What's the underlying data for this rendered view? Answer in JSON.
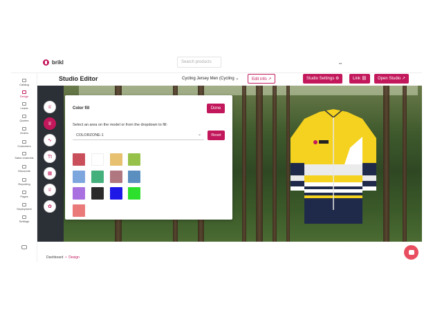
{
  "app": {
    "logo_text": "brikl"
  },
  "search": {
    "placeholder": "Search products"
  },
  "user": {
    "label": "•••"
  },
  "sidebar": {
    "items": [
      {
        "label": "Catalog"
      },
      {
        "label": "Design"
      },
      {
        "label": "Leads"
      },
      {
        "label": "Quotes"
      },
      {
        "label": "Orders"
      },
      {
        "label": "Customers"
      },
      {
        "label": "Sales channels"
      },
      {
        "label": "Discounts"
      },
      {
        "label": "Reporting"
      },
      {
        "label": "Pages"
      },
      {
        "label": "Deployment"
      },
      {
        "label": "Settings"
      }
    ]
  },
  "header": {
    "title": "Studio Editor",
    "product_select": "Cycling Jersey Men (Cycling",
    "edit_info": "Edit info",
    "studio_settings": "Studio Settings",
    "link": "Link",
    "open_studio": "Open Studio"
  },
  "tools": [
    {
      "icon": "jersey-icon"
    },
    {
      "icon": "color-fill-icon"
    },
    {
      "icon": "pattern-icon"
    },
    {
      "icon": "text-icon",
      "label": "Tt"
    },
    {
      "icon": "image-icon"
    },
    {
      "icon": "logo-icon"
    },
    {
      "icon": "sticker-icon"
    }
  ],
  "panel": {
    "title": "Color fill",
    "done": "Done",
    "instruction": "Select an area on the model or from the dropdown to fill:",
    "zone_value": "COLORZONE-1",
    "reset": "Reset",
    "swatches": [
      "#c9505a",
      "#ffffff",
      "#e7c070",
      "#97c24a",
      "#7ea6de",
      "#44b07c",
      "#b07780",
      "#5b8fc0",
      "#a970e0",
      "#2b2b2b",
      "#1f19e8",
      "#2ee02e",
      "#ea7a7a"
    ]
  },
  "breadcrumb": {
    "root": "Dashboard",
    "current": "Design"
  },
  "colors": {
    "accent": "#c2185b",
    "jersey_yellow": "#f4d21f",
    "jersey_navy": "#1f2a4a",
    "chat": "#e94e60"
  }
}
